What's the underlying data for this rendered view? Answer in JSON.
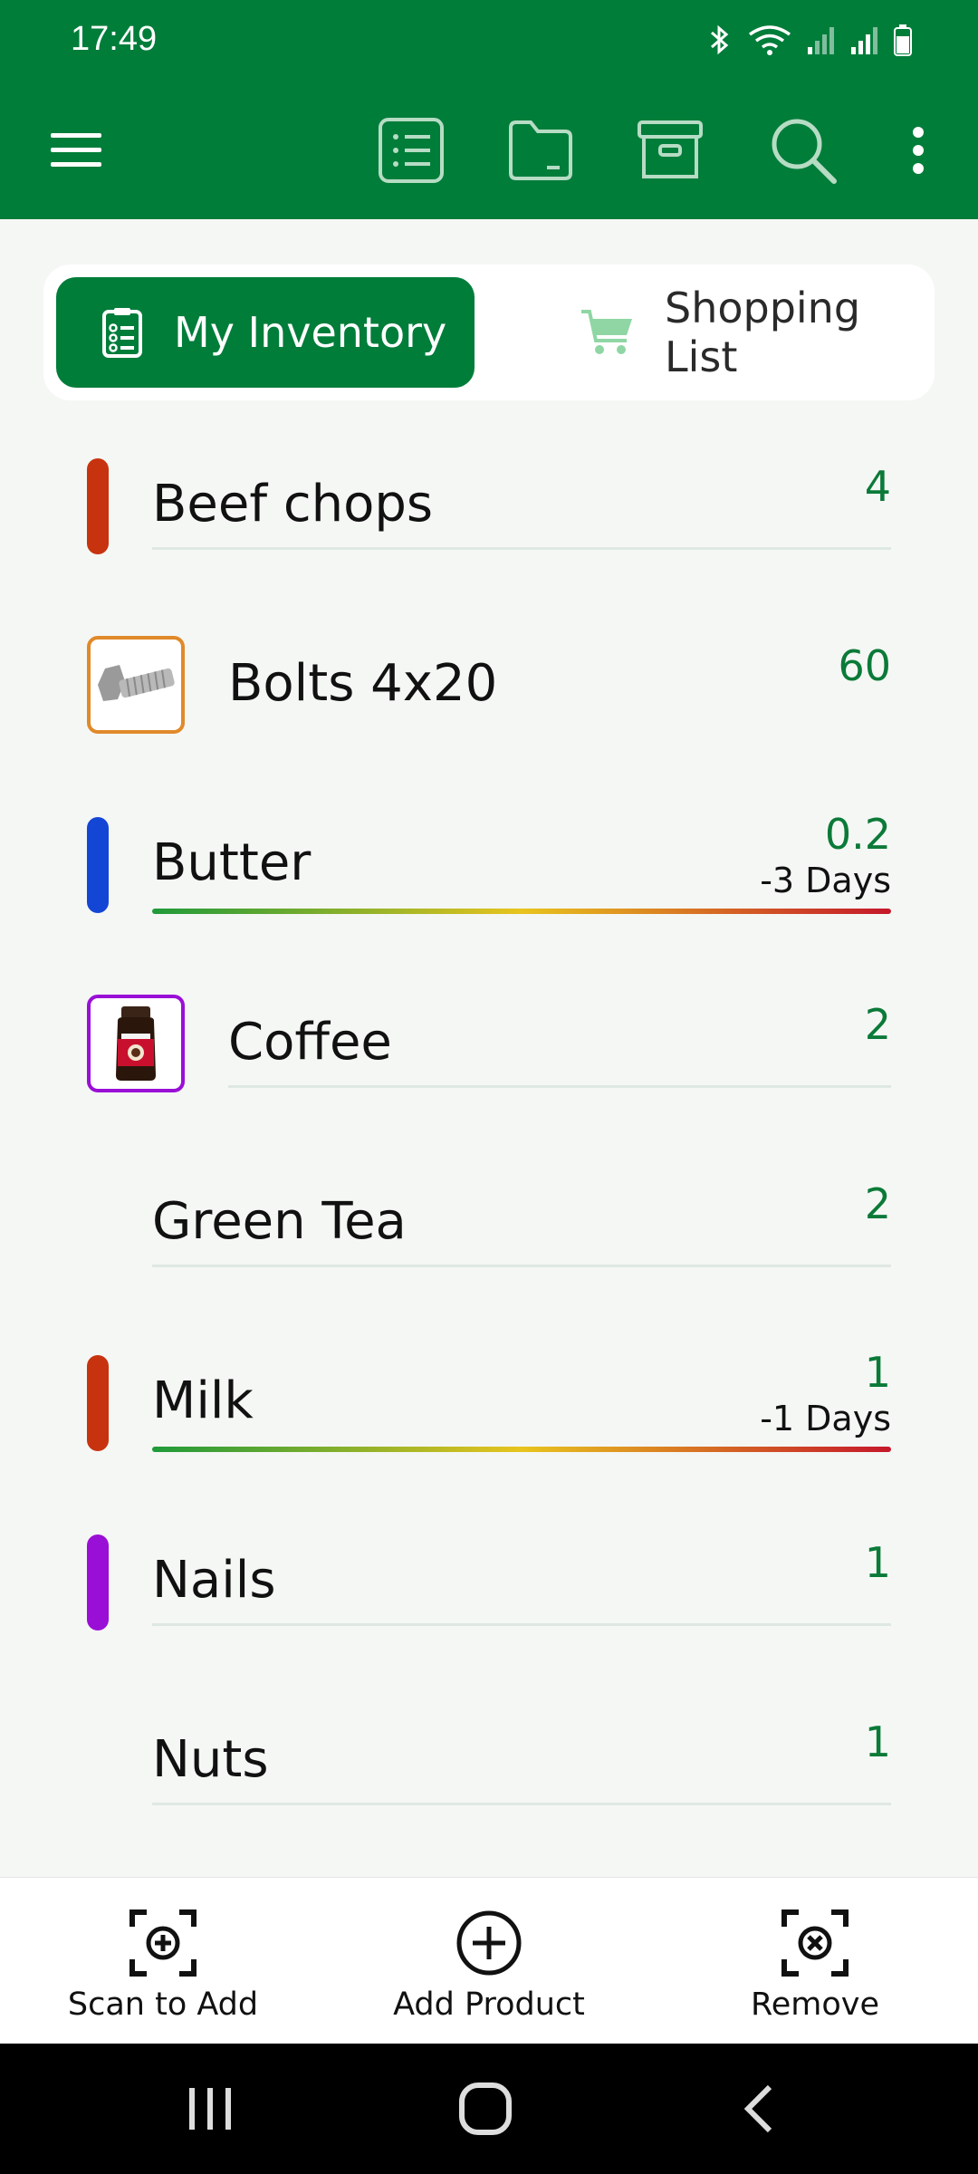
{
  "status_bar": {
    "time": "17:49",
    "icons": [
      "bluetooth-icon",
      "wifi-icon",
      "signal-icon",
      "signal-icon",
      "battery-icon"
    ]
  },
  "toolbar": {
    "icons": [
      "menu-icon",
      "list-icon",
      "folder-icon",
      "archive-icon",
      "search-icon",
      "more-vert-icon"
    ],
    "accent_color": "#017d3a"
  },
  "tabs": [
    {
      "label": "My Inventory",
      "icon": "clipboard-icon",
      "active": true
    },
    {
      "label": "Shopping List",
      "icon": "cart-icon",
      "active": false
    }
  ],
  "items": [
    {
      "name": "Beef chops",
      "qty": "4",
      "marker": "bar",
      "color": "#c8330f"
    },
    {
      "name": "Bolts 4x20",
      "qty": "60",
      "marker": "thumb",
      "color": "#e08a2a",
      "thumb_icon": "bolt-icon"
    },
    {
      "name": "Butter",
      "qty": "0.2",
      "days": "-3 Days",
      "marker": "bar",
      "color": "#1446d6",
      "expiry": true
    },
    {
      "name": "Coffee",
      "qty": "2",
      "marker": "thumb",
      "color": "#9a0fd6",
      "thumb_icon": "coffee-jar-icon"
    },
    {
      "name": "Green Tea",
      "qty": "2",
      "marker": "none"
    },
    {
      "name": "Milk",
      "qty": "1",
      "days": "-1 Days",
      "marker": "bar",
      "color": "#c8330f",
      "expiry": true
    },
    {
      "name": "Nails",
      "qty": "1",
      "marker": "bar",
      "color": "#9a0fd6"
    },
    {
      "name": "Nuts",
      "qty": "1",
      "marker": "none"
    }
  ],
  "bottom_actions": [
    {
      "label": "Scan to Add",
      "icon": "scan-add-icon"
    },
    {
      "label": "Add Product",
      "icon": "add-circle-icon"
    },
    {
      "label": "Remove",
      "icon": "scan-remove-icon"
    }
  ],
  "nav": [
    "recent-apps-icon",
    "home-icon",
    "back-icon"
  ]
}
